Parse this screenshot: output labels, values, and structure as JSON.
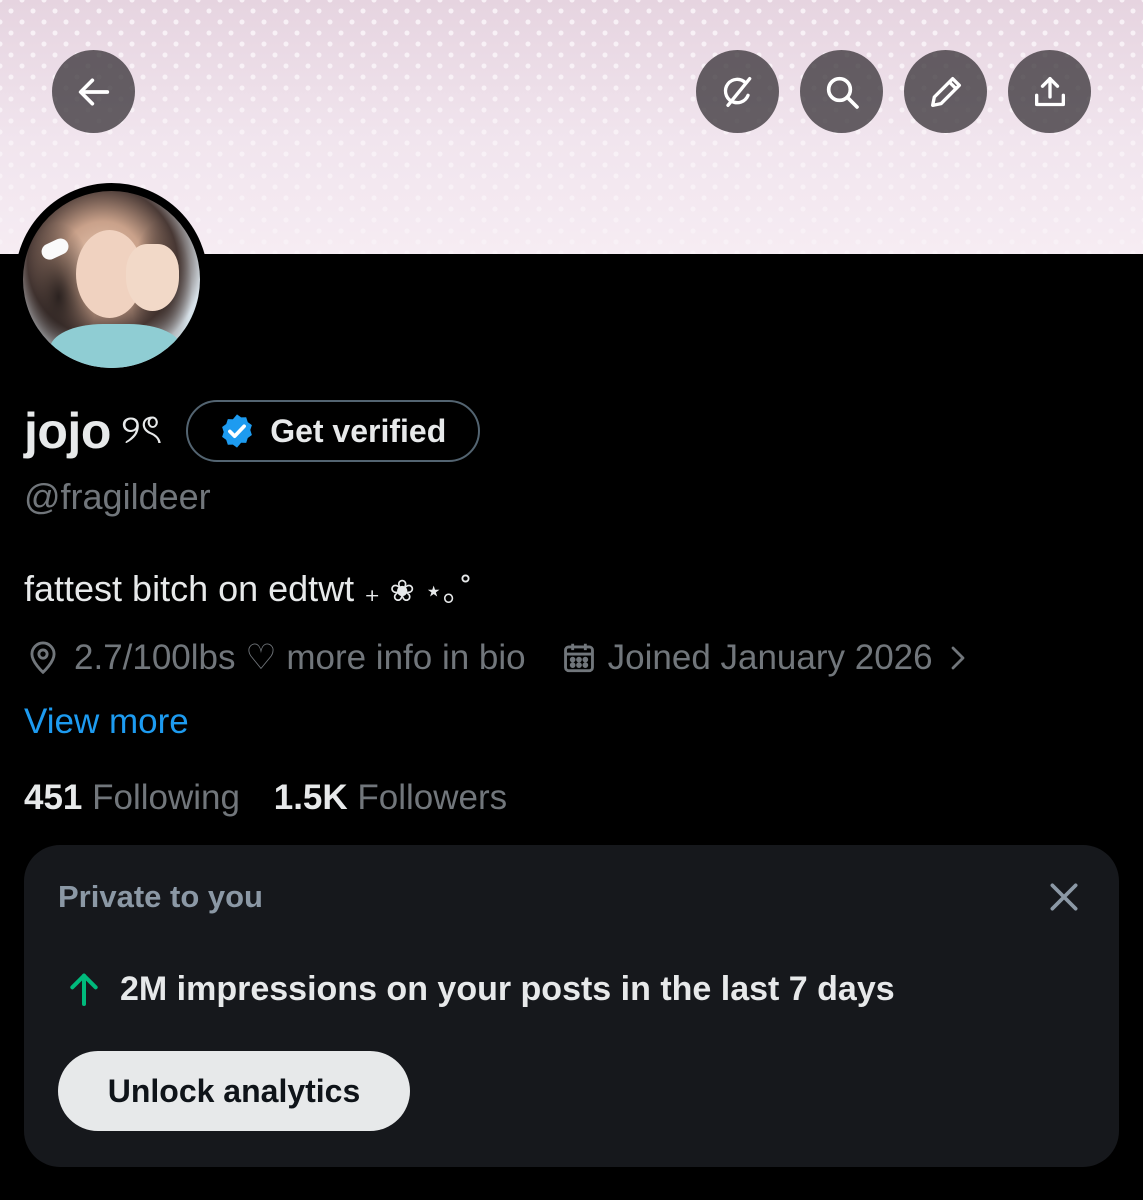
{
  "header": {
    "buttons": [
      {
        "icon": "back-arrow-icon"
      },
      {
        "icon": "grok-icon"
      },
      {
        "icon": "search-icon"
      },
      {
        "icon": "edit-icon"
      },
      {
        "icon": "share-icon"
      }
    ]
  },
  "profile": {
    "display_name": "jojo",
    "name_decoration": "୨ৎ",
    "verify_label": "Get verified",
    "handle": "@fragildeer",
    "bio": "fattest bitch on edtwt",
    "bio_decoration": "₊ ❀ ⋆｡˚",
    "location": "2.7/100lbs ♡ more info in bio",
    "joined": "Joined January 2026",
    "view_more": "View more",
    "following_count": "451",
    "following_label": "Following",
    "followers_count": "1.5K",
    "followers_label": "Followers"
  },
  "private_card": {
    "title": "Private to you",
    "impressions_text": "2M impressions on your posts in the last 7 days",
    "unlock_label": "Unlock analytics"
  },
  "colors": {
    "background": "#000000",
    "accent_blue": "#1d9bf0",
    "muted_text": "#71767b",
    "up_arrow_green": "#00ba7c",
    "card_bg": "#16181c"
  }
}
